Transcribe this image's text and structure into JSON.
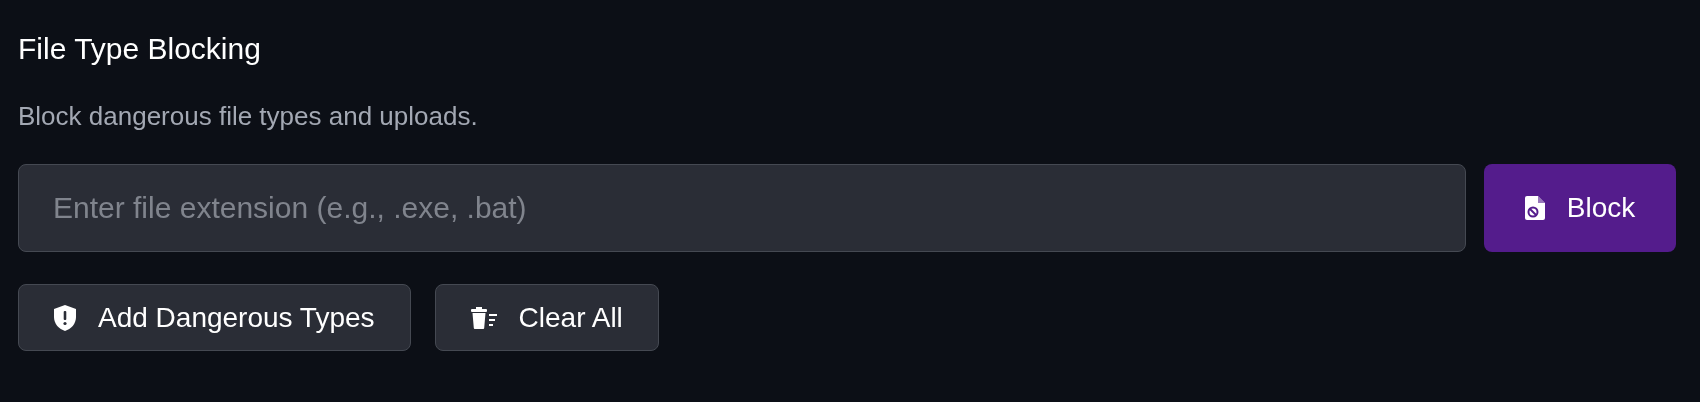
{
  "section": {
    "title": "File Type Blocking",
    "description": "Block dangerous file types and uploads."
  },
  "extension_field": {
    "placeholder": "Enter file extension (e.g., .exe, .bat)"
  },
  "block_button": {
    "label": "Block"
  },
  "actions": [
    {
      "label": "Add Dangerous Types",
      "kind": "add"
    },
    {
      "label": "Clear All",
      "kind": "clear"
    }
  ]
}
